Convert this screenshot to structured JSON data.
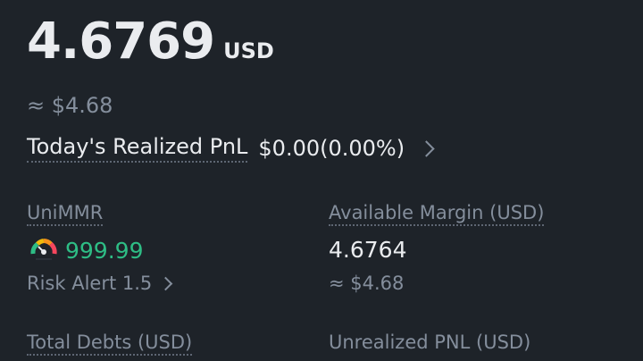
{
  "balance": {
    "value": "4.6769",
    "unit": "USD",
    "approx": "≈ $4.68"
  },
  "pnl": {
    "label": "Today's Realized PnL",
    "value": "$0.00(0.00%)"
  },
  "unimmr": {
    "label": "UniMMR",
    "value": "999.99",
    "risk_alert": "Risk Alert 1.5",
    "gauge_icon": "gauge-icon",
    "value_color": "#2ebd85"
  },
  "available_margin": {
    "label": "Available Margin (USD)",
    "value": "4.6764",
    "approx": "≈ $4.68"
  },
  "total_debts": {
    "label": "Total Debts (USD)"
  },
  "unrealized_pnl": {
    "label": "Unrealized PNL (USD)"
  },
  "colors": {
    "background": "#1e2329",
    "primary_text": "#eaecef",
    "secondary_text": "#848e9c",
    "positive": "#2ebd85"
  }
}
